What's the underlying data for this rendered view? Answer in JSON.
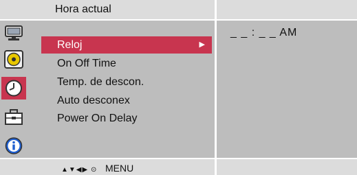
{
  "header": {
    "title": "Hora actual"
  },
  "sidebar": {
    "icons": [
      {
        "name": "monitor-icon",
        "active": false
      },
      {
        "name": "disc-icon",
        "active": false
      },
      {
        "name": "clock-icon",
        "active": true
      },
      {
        "name": "toolbox-icon",
        "active": false
      },
      {
        "name": "info-icon",
        "active": false
      }
    ]
  },
  "menu": {
    "items": [
      {
        "label": "Reloj",
        "selected": true
      },
      {
        "label": "On Off Time",
        "selected": false
      },
      {
        "label": "Temp. de descon.",
        "selected": false
      },
      {
        "label": "Auto desconex",
        "selected": false
      },
      {
        "label": "Power On Delay",
        "selected": false
      }
    ],
    "selected_arrow": "▶"
  },
  "value": {
    "time": "_ _ : _ _  AM"
  },
  "footer": {
    "nav_glyphs": "▲▼◀▶ ⊙",
    "menu_label": "MENU"
  },
  "colors": {
    "accent": "#c8354f",
    "panel": "#bdbdbd",
    "bar": "#dcdcdc"
  }
}
